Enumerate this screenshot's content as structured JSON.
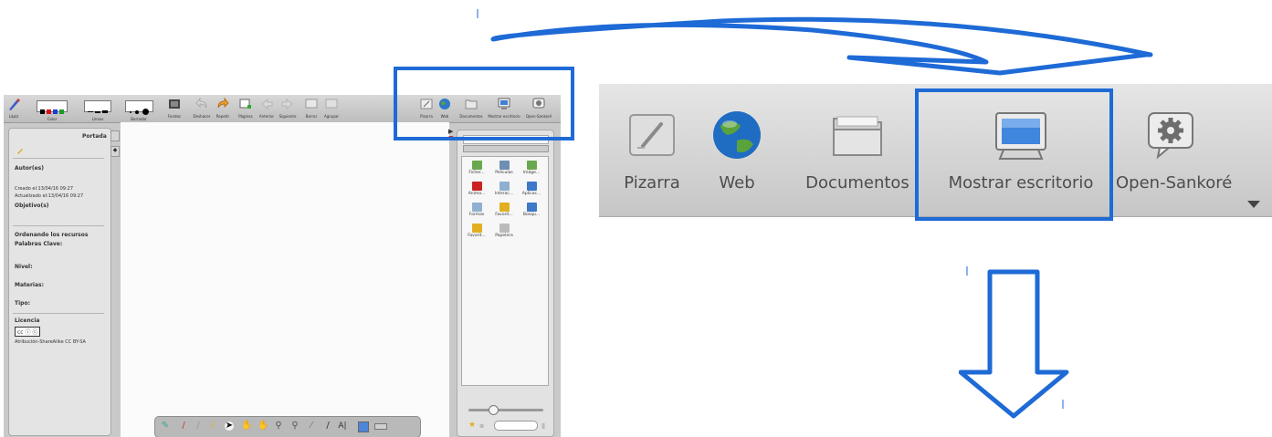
{
  "small": {
    "toolbar": {
      "lapiz": "Lápiz",
      "color": "Color",
      "lineas": "Líneas",
      "borrador": "Borrador",
      "fondos": "Fondos",
      "deshacer": "Deshacer",
      "repetir": "Repetir",
      "paginas": "Páginas",
      "anterior": "Anterior",
      "siguiente": "Siguiente",
      "borrar": "Borrar",
      "agrupar": "Agrupar",
      "pizarra": "Pizarra",
      "web": "Web",
      "documentos": "Documentos",
      "mostrar_escritorio": "Mostrar escritorio",
      "open_sankore": "Open-Sankoré"
    },
    "left_panel": {
      "title": "Portada",
      "autor": "Autor(es)",
      "creado": "Creado el:13/04/16 09:27",
      "actualizado": "Actualizado el:13/04/16 09:27",
      "objetivo": "Objetivo(s)",
      "ordenando": "Ordenando los recursos",
      "palabras": "Palabras Clave:",
      "nivel": "Nivel:",
      "materias": "Materias:",
      "tipo": "Tipo:",
      "licencia": "Licencia",
      "cc_badge": "cc ⓘ ⓒ",
      "licencia_texto": "Atribución-ShareAlike CC BY-SA"
    },
    "library": {
      "items": [
        {
          "label": "Ficher...",
          "color": "#6aa84f"
        },
        {
          "label": "Películas",
          "color": "#6d8fb3"
        },
        {
          "label": "Imáge...",
          "color": "#6aa84f"
        },
        {
          "label": "Anima...",
          "color": "#cc2222"
        },
        {
          "label": "Interac...",
          "color": "#8fb0d0"
        },
        {
          "label": "Aplicac...",
          "color": "#3d78c9"
        },
        {
          "label": "Formas",
          "color": "#8fb0d0"
        },
        {
          "label": "Favorit...",
          "color": "#e0b020"
        },
        {
          "label": "Búsqu...",
          "color": "#3d78c9"
        },
        {
          "label": "Favorit...",
          "color": "#e0b020"
        },
        {
          "label": "Papelera",
          "color": "#bbbbbb"
        }
      ]
    }
  },
  "big": {
    "pizarra": "Pizarra",
    "web": "Web",
    "documentos": "Documentos",
    "mostrar_escritorio": "Mostrar escritorio",
    "open_sankore": "Open-Sankoré"
  },
  "colors": {
    "highlight": "#1e6ad6",
    "arrow": "#1e6ad6"
  }
}
